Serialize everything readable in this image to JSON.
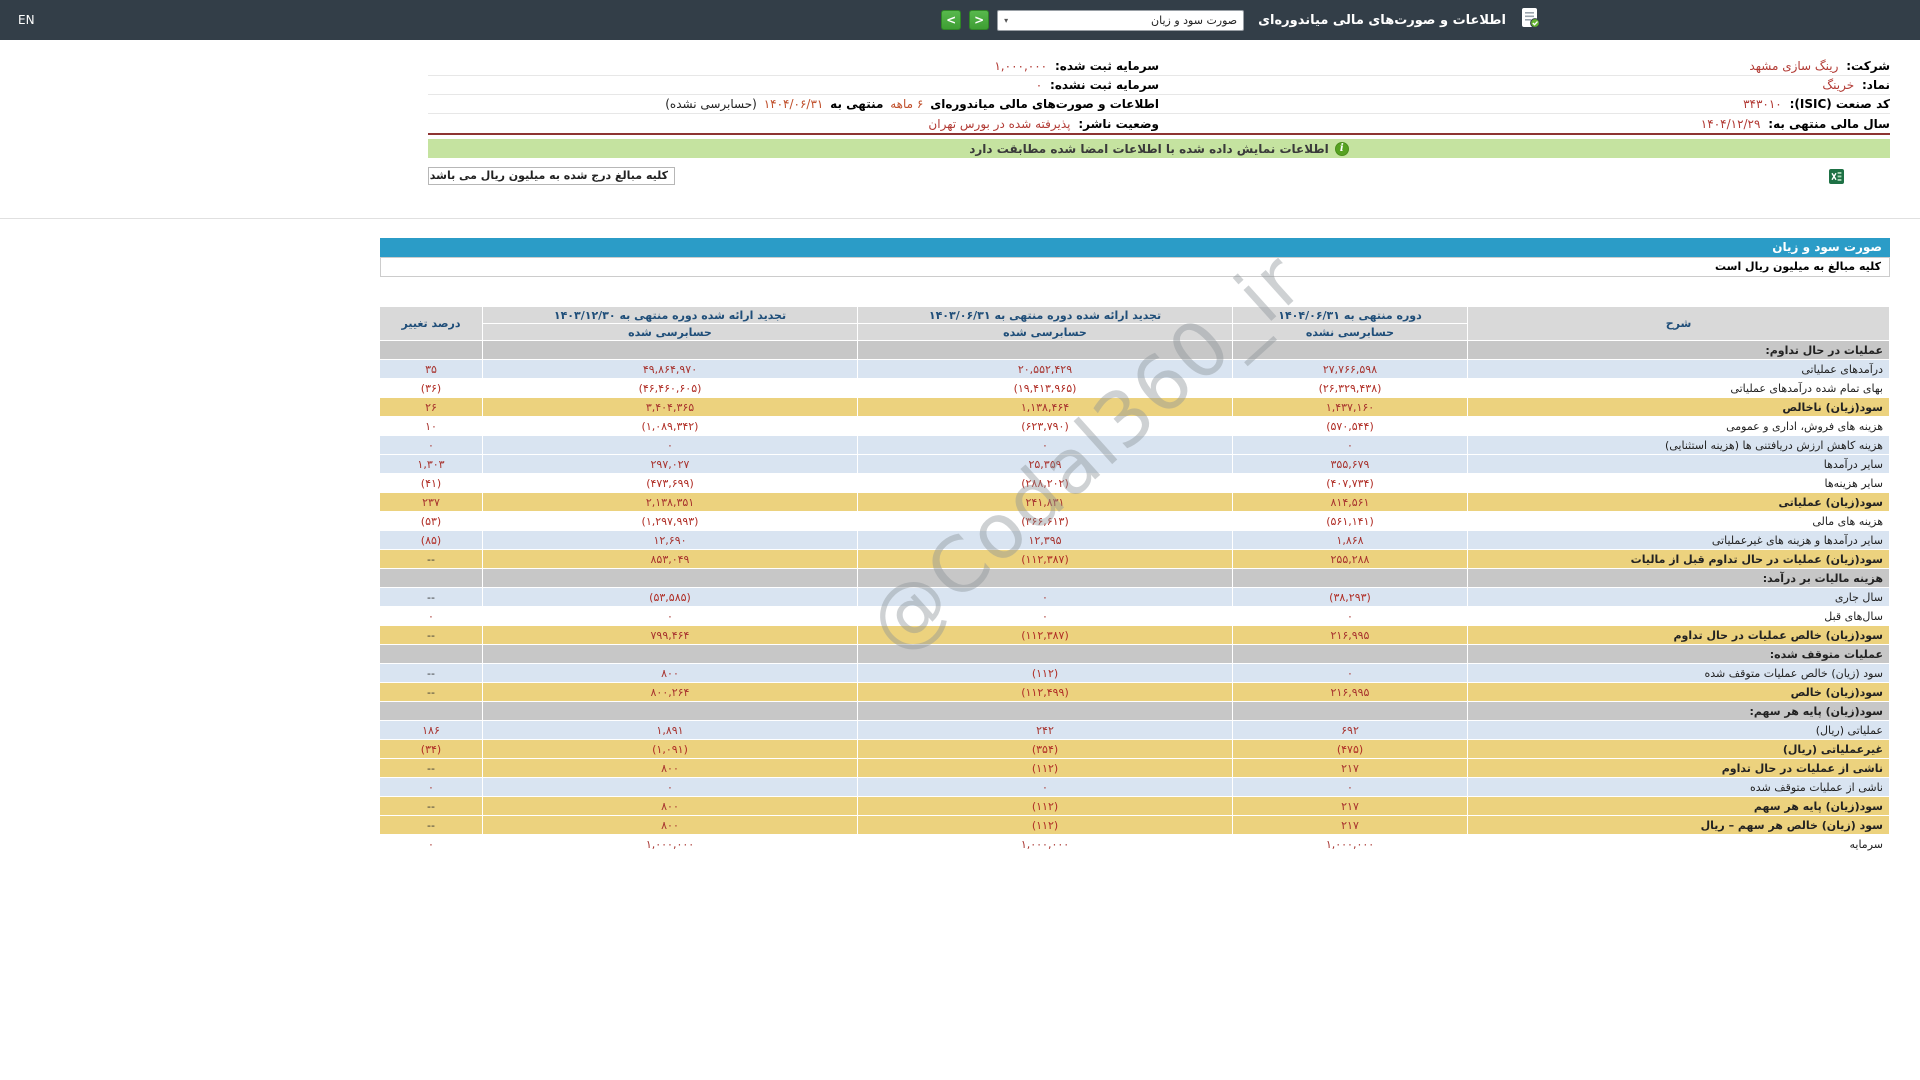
{
  "header": {
    "language_link": "EN",
    "title": "اطلاعات و صورت‌های مالی میاندوره‌ای",
    "report_type_selected": "صورت سود و زیان",
    "select_caret": "▾",
    "nav_next": ">",
    "nav_prev": "<"
  },
  "company_info": {
    "company_label": "شرکت:",
    "company_value": "رینگ سازی مشهد",
    "registered_capital_label": "سرمایه ثبت شده:",
    "registered_capital_value": "۱,۰۰۰,۰۰۰",
    "symbol_label": "نماد:",
    "symbol_value": "خرینگ",
    "unregistered_capital_label": "سرمایه ثبت نشده:",
    "unregistered_capital_value": "۰",
    "isic_label": "کد صنعت (ISIC):",
    "isic_value": "۳۴۳۰۱۰",
    "period_prefix": "اطلاعات و صورت‌های مالی میاندوره‌ای",
    "period_length": "۶ ماهه",
    "period_mid": "منتهی به",
    "period_date": "۱۴۰۴/۰۶/۳۱",
    "period_suffix": "(حسابرسی نشده)",
    "fiscal_year_label": "سال مالی منتهی به:",
    "fiscal_year_value": "۱۴۰۴/۱۲/۲۹",
    "issuer_status_label": "وضعیت ناشر:",
    "issuer_status_value": "پذیرفته شده در بورس تهران"
  },
  "banner": {
    "info_icon": "i",
    "text": "اطلاعات نمایش داده شده با اطلاعات امضا شده مطابقت دارد"
  },
  "unit_note_box": "کلیه مبالغ درج شده به میلیون ریال می باشد",
  "statement": {
    "title": "صورت سود و زیان",
    "unit_note": "کلیه مبالغ به میلیون ریال است"
  },
  "watermark": "@Codal360_ir",
  "table": {
    "headers": {
      "description": "شرح",
      "current_period": "دوره منتهی به ۱۴۰۴/۰۶/۳۱",
      "current_period_audit": "حسابرسی نشده",
      "restated_6m": "تجدید ارائه شده دوره منتهی به ۱۴۰۳/۰۶/۳۱",
      "restated_6m_audit": "حسابرسی شده",
      "restated_12m": "تجدید ارائه شده دوره منتهی به ۱۴۰۳/۱۲/۳۰",
      "restated_12m_audit": "حسابرسی شده",
      "change_percent": "درصد تغییر"
    },
    "rows": [
      {
        "label": "عملیات در حال تداوم:",
        "values": [
          "",
          "",
          "",
          ""
        ],
        "style": "section"
      },
      {
        "label": "درآمدهای عملیاتی",
        "values": [
          "۲۷,۷۶۶,۵۹۸",
          "۲۰,۵۵۲,۴۲۹",
          "۴۹,۸۶۴,۹۷۰",
          "۳۵"
        ],
        "style": "blue"
      },
      {
        "label": "بهای تمام شده درآمدهای عملیاتی",
        "values": [
          "(۲۶,۳۲۹,۴۳۸)",
          "(۱۹,۴۱۳,۹۶۵)",
          "(۴۶,۴۶۰,۶۰۵)",
          "(۳۶)"
        ],
        "style": "white"
      },
      {
        "label": "سود(زیان) ناخالص",
        "values": [
          "۱,۴۳۷,۱۶۰",
          "۱,۱۳۸,۴۶۴",
          "۳,۴۰۴,۳۶۵",
          "۲۶"
        ],
        "style": "khaki"
      },
      {
        "label": "هزینه های فروش، اداری و عمومی",
        "values": [
          "(۵۷۰,۵۴۴)",
          "(۶۲۳,۷۹۰)",
          "(۱,۰۸۹,۳۴۲)",
          "۱۰"
        ],
        "style": "white"
      },
      {
        "label": "هزینه کاهش ارزش دریافتنی ها (هزینه استثنایی)",
        "values": [
          "۰",
          "۰",
          "۰",
          "۰"
        ],
        "style": "blue"
      },
      {
        "label": "سایر درآمدها",
        "values": [
          "۳۵۵,۶۷۹",
          "۲۵,۳۵۹",
          "۲۹۷,۰۲۷",
          "۱,۳۰۳"
        ],
        "style": "blue"
      },
      {
        "label": "سایر هزینه‌ها",
        "values": [
          "(۴۰۷,۷۳۴)",
          "(۲۸۸,۲۰۲)",
          "(۴۷۳,۶۹۹)",
          "(۴۱)"
        ],
        "style": "white"
      },
      {
        "label": "سود(زیان) عملیاتی",
        "values": [
          "۸۱۴,۵۶۱",
          "۲۴۱,۸۳۱",
          "۲,۱۳۸,۳۵۱",
          "۲۳۷"
        ],
        "style": "khaki"
      },
      {
        "label": "هزینه های مالی",
        "values": [
          "(۵۶۱,۱۴۱)",
          "(۳۶۶,۶۱۳)",
          "(۱,۲۹۷,۹۹۳)",
          "(۵۳)"
        ],
        "style": "white"
      },
      {
        "label": "سایر درآمدها و هزینه های غیرعملیاتی",
        "values": [
          "۱,۸۶۸",
          "۱۲,۳۹۵",
          "۱۲,۶۹۰",
          "(۸۵)"
        ],
        "style": "blue"
      },
      {
        "label": "سود(زیان) عملیات در حال تداوم قبل از مالیات",
        "values": [
          "۲۵۵,۲۸۸",
          "(۱۱۲,۳۸۷)",
          "۸۵۳,۰۴۹",
          "--"
        ],
        "style": "khaki"
      },
      {
        "label": "هزینه مالیات بر درآمد:",
        "values": [
          "",
          "",
          "",
          ""
        ],
        "style": "section"
      },
      {
        "label": "سال جاری",
        "values": [
          "(۳۸,۲۹۳)",
          "۰",
          "(۵۳,۵۸۵)",
          "--"
        ],
        "style": "blue"
      },
      {
        "label": "سال‌های قبل",
        "values": [
          "۰",
          "۰",
          "۰",
          "۰"
        ],
        "style": "white"
      },
      {
        "label": "سود(زیان) خالص عملیات در حال تداوم",
        "values": [
          "۲۱۶,۹۹۵",
          "(۱۱۲,۳۸۷)",
          "۷۹۹,۴۶۴",
          "--"
        ],
        "style": "khaki"
      },
      {
        "label": "عملیات متوقف شده:",
        "values": [
          "",
          "",
          "",
          ""
        ],
        "style": "section"
      },
      {
        "label": "سود (زیان) خالص عملیات متوقف شده",
        "values": [
          "۰",
          "(۱۱۲)",
          "۸۰۰",
          "--"
        ],
        "style": "blue"
      },
      {
        "label": "سود(زیان) خالص",
        "values": [
          "۲۱۶,۹۹۵",
          "(۱۱۲,۴۹۹)",
          "۸۰۰,۲۶۴",
          "--"
        ],
        "style": "khaki"
      },
      {
        "label": "سود(زیان) پایه هر سهم:",
        "values": [
          "",
          "",
          "",
          ""
        ],
        "style": "section"
      },
      {
        "label": "عملیاتی (ریال)",
        "values": [
          "۶۹۲",
          "۲۴۲",
          "۱,۸۹۱",
          "۱۸۶"
        ],
        "style": "blue"
      },
      {
        "label": "غیرعملیاتی (ریال)",
        "values": [
          "(۴۷۵)",
          "(۳۵۴)",
          "(۱,۰۹۱)",
          "(۳۴)"
        ],
        "style": "khaki"
      },
      {
        "label": "ناشی از عملیات در حال تداوم",
        "values": [
          "۲۱۷",
          "(۱۱۲)",
          "۸۰۰",
          "--"
        ],
        "style": "khaki"
      },
      {
        "label": "ناشی از عملیات متوقف شده",
        "values": [
          "۰",
          "۰",
          "۰",
          "۰"
        ],
        "style": "blue"
      },
      {
        "label": "سود(زیان) پایه هر سهم",
        "values": [
          "۲۱۷",
          "(۱۱۲)",
          "۸۰۰",
          "--"
        ],
        "style": "khaki"
      },
      {
        "label": "سود (زیان) خالص هر سهم – ریال",
        "values": [
          "۲۱۷",
          "(۱۱۲)",
          "۸۰۰",
          "--"
        ],
        "style": "khaki"
      },
      {
        "label": "سرمایه",
        "values": [
          "۱,۰۰۰,۰۰۰",
          "۱,۰۰۰,۰۰۰",
          "۱,۰۰۰,۰۰۰",
          "۰"
        ],
        "style": "white"
      }
    ]
  },
  "colors": {
    "header_bar": "#333e48",
    "title_bar_blue": "#2b9cc7",
    "banner_green": "#c5e3a0",
    "row_blue": "#d9e4f1",
    "row_khaki": "#ecd27e",
    "row_section_gray": "#c7c7c7",
    "value_red": "#a8342f",
    "divider_maroon": "#8e3433"
  }
}
